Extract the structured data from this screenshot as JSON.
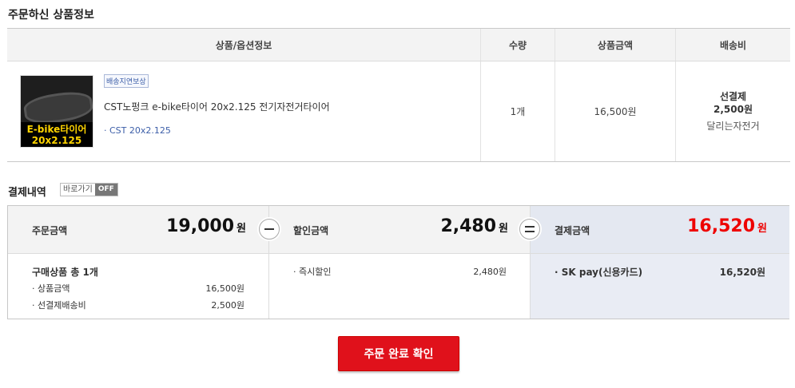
{
  "order_section": {
    "title": "주문하신 상품정보",
    "headers": [
      "상품/옵션정보",
      "수량",
      "상품금액",
      "배송비"
    ],
    "item": {
      "thumb_caption_1": "E-bike타이어",
      "thumb_caption_2": "20x2.125",
      "badge": "배송지연보상",
      "name": "CST노펑크 e-bike타이어 20x2.125 전기자전거타이어",
      "option": "· CST 20x2.125",
      "quantity": "1개",
      "price": "16,500원",
      "ship_type": "선결제",
      "ship_fee": "2,500원",
      "seller": "달리는자전거"
    }
  },
  "payment_section": {
    "title": "결제내역",
    "toggle_label": "바로가기",
    "toggle_state": "OFF",
    "order_amount_label": "주문금액",
    "order_amount": "19,000",
    "won": "원",
    "discount_label": "할인금액",
    "discount_amount": "2,480",
    "final_label": "결제금액",
    "final_amount": "16,520",
    "purchase_summary": "구매상품 총 1개",
    "product_amount_label": "· 상품금액",
    "product_amount": "16,500원",
    "prepaid_shipping_label": "· 선결제배송비",
    "prepaid_shipping": "2,500원",
    "instant_discount_label": "· 즉시할인",
    "instant_discount": "2,480원",
    "method_label": "· SK pay(신용카드)",
    "method_amount": "16,520원"
  },
  "confirm_button": "주문 완료 확인",
  "colors": {
    "accent_red": "#e0111b",
    "final_price_red": "#ee0000",
    "link_blue": "#3c5ea8"
  }
}
